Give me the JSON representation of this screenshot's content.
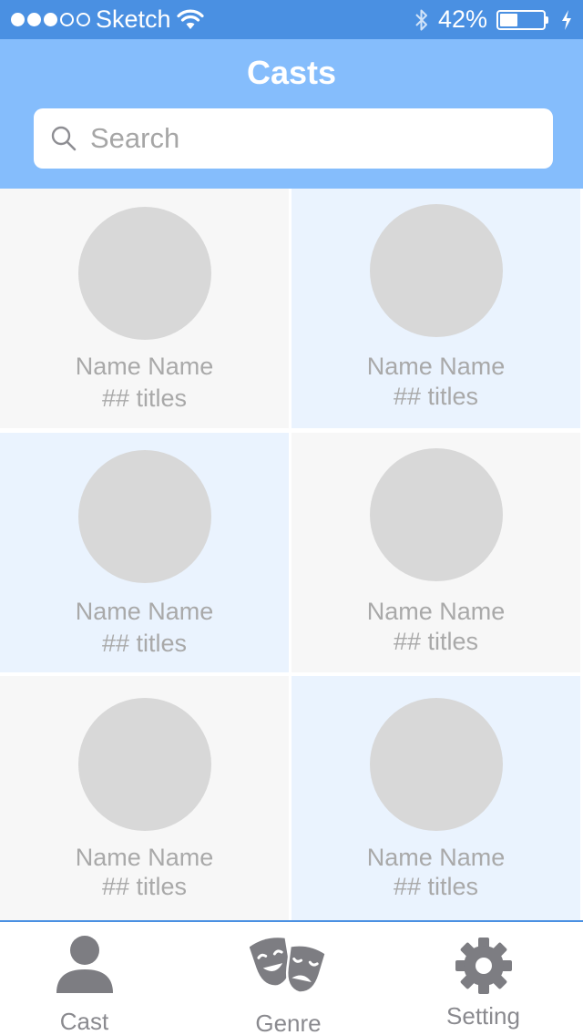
{
  "status_bar": {
    "carrier": "Sketch",
    "battery_percent": "42%",
    "battery_level": 0.42,
    "signal_strength": 3,
    "signal_total": 5
  },
  "header": {
    "title": "Casts",
    "search": {
      "placeholder": "Search",
      "value": ""
    }
  },
  "cast_grid": [
    {
      "name": "Name Name",
      "titles": "## titles"
    },
    {
      "name": "Name Name",
      "titles": "## titles"
    },
    {
      "name": "Name Name",
      "titles": "## titles"
    },
    {
      "name": "Name Name",
      "titles": "## titles"
    },
    {
      "name": "Name Name",
      "titles": "## titles"
    },
    {
      "name": "Name Name",
      "titles": "## titles"
    }
  ],
  "tab_bar": {
    "tabs": [
      {
        "label": "Cast",
        "icon": "person-icon"
      },
      {
        "label": "Genre",
        "icon": "theater-masks-icon"
      },
      {
        "label": "Setting",
        "icon": "gear-icon"
      }
    ]
  },
  "colors": {
    "status_bar": "#4a90e2",
    "header": "#85bdfc",
    "cell_gray": "#f7f7f7",
    "cell_blue": "#eaf3fe",
    "avatar": "#d8d8d8",
    "tab_icon": "#7d7d82"
  }
}
